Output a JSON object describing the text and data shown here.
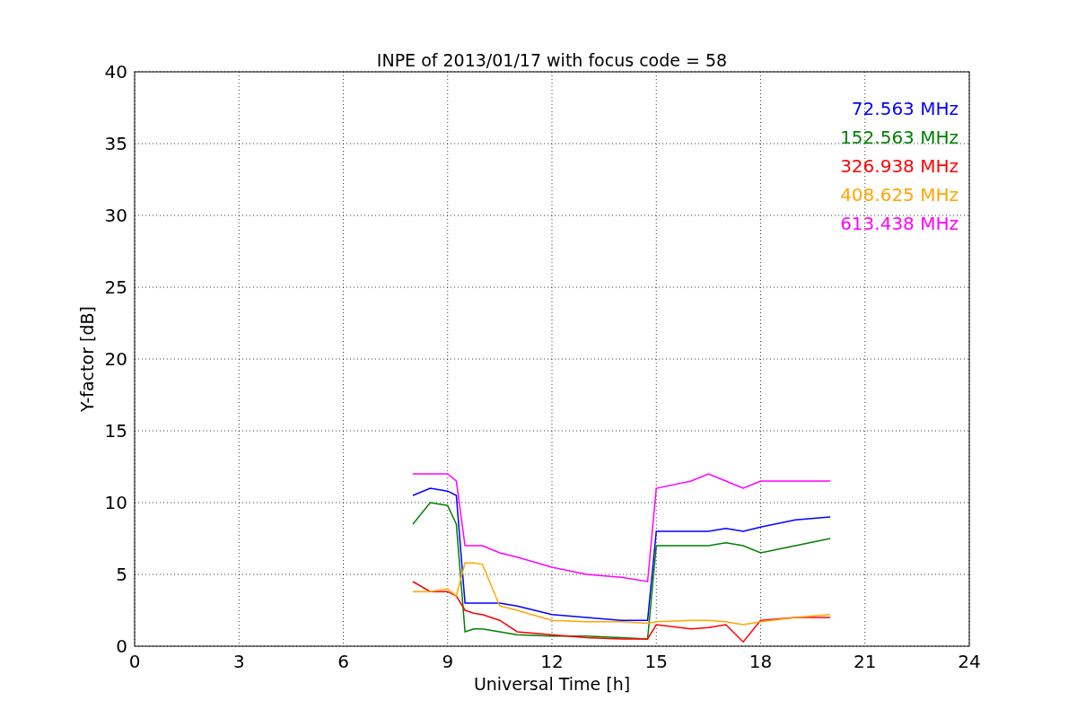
{
  "chart": {
    "chart_data": {
      "type": "line",
      "title": "INPE of 2013/01/17 with focus code = 58",
      "xlabel": "Universal Time [h]",
      "ylabel": "Y-factor [dB]",
      "x": [
        8,
        8.5,
        9,
        9.25,
        9.5,
        9.75,
        10,
        10.5,
        11,
        12,
        13,
        14,
        14.75,
        15,
        16,
        16.5,
        17,
        17.5,
        18,
        19,
        20
      ],
      "series": [
        {
          "name": "72.563 MHz",
          "color": "#0000ff",
          "values": [
            10.5,
            11,
            10.8,
            10.5,
            3,
            3,
            3,
            3,
            2.8,
            2.2,
            2,
            1.8,
            1.8,
            8,
            8,
            8,
            8.2,
            8,
            8.3,
            8.8,
            9
          ]
        },
        {
          "name": "152.563 MHz",
          "color": "#008000",
          "values": [
            8.5,
            10,
            9.8,
            8.5,
            1,
            1.2,
            1.2,
            1,
            0.8,
            0.7,
            0.7,
            0.6,
            0.5,
            7,
            7,
            7,
            7.2,
            7,
            6.5,
            7,
            7.5
          ]
        },
        {
          "name": "326.938 MHz",
          "color": "#ff0000",
          "values": [
            4.5,
            3.8,
            3.8,
            3.5,
            2.5,
            2.3,
            2.2,
            1.8,
            1,
            0.8,
            0.6,
            0.5,
            0.5,
            1.5,
            1.2,
            1.3,
            1.5,
            0.3,
            1.8,
            2,
            2
          ]
        },
        {
          "name": "408.625 MHz",
          "color": "#ffa500",
          "values": [
            3.8,
            3.8,
            4,
            3.5,
            5.8,
            5.8,
            5.7,
            2.8,
            2.5,
            1.8,
            1.7,
            1.7,
            1.6,
            1.7,
            1.8,
            1.8,
            1.7,
            1.5,
            1.7,
            2,
            2.2
          ]
        },
        {
          "name": "613.438 MHz",
          "color": "#ff00ff",
          "values": [
            12,
            12,
            12,
            11.5,
            7,
            7,
            7,
            6.5,
            6.2,
            5.5,
            5,
            4.8,
            4.5,
            11,
            11.5,
            12,
            11.5,
            11,
            11.5,
            11.5,
            11.5
          ]
        }
      ],
      "grid": true,
      "xlim": [
        0,
        24
      ],
      "ylim": [
        0,
        40
      ],
      "xticks": [
        0,
        3,
        6,
        9,
        12,
        15,
        18,
        21,
        24
      ],
      "yticks": [
        0,
        5,
        10,
        15,
        20,
        25,
        30,
        35,
        40
      ]
    }
  }
}
